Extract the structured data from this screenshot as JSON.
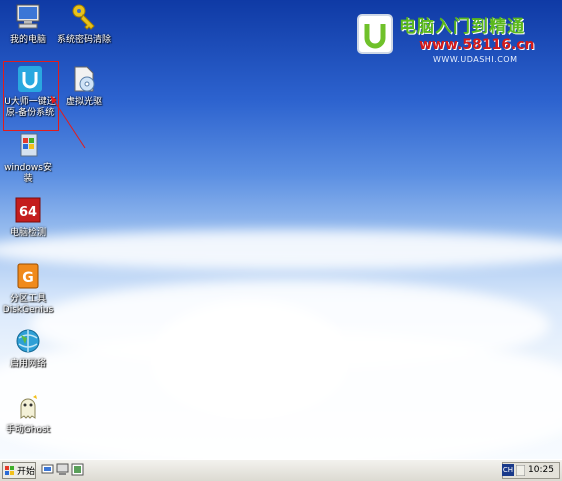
{
  "desktop": {
    "icons": [
      {
        "id": "my-computer",
        "label": "我的电脑",
        "icon": "computer-icon"
      },
      {
        "id": "password-clear",
        "label": "系统密码清除",
        "icon": "key-icon"
      },
      {
        "id": "udashi-backup",
        "label": "U大师一键还\n原-备份系统",
        "icon": "udashi-icon"
      },
      {
        "id": "virtual-drive",
        "label": "虚拟光驱",
        "icon": "cd-icon"
      },
      {
        "id": "windows-install",
        "label": "windows安装",
        "icon": "windows-setup-icon"
      },
      {
        "id": "cpu-detect",
        "label": "电脑检测",
        "icon": "aida64-icon"
      },
      {
        "id": "diskgenius",
        "label": "分区工具\nDiskGenius",
        "icon": "diskgenius-icon"
      },
      {
        "id": "network",
        "label": "启用网络",
        "icon": "network-icon"
      },
      {
        "id": "manual-ghost",
        "label": "手动Ghost",
        "icon": "ghost-icon"
      }
    ]
  },
  "logo": {
    "title": "电脑入门到精通",
    "url": "www.58116.cn",
    "sub": "WWW.UDASHI.COM"
  },
  "taskbar": {
    "start_label": "开始",
    "lang": "CH",
    "clock": "10:25"
  },
  "colors": {
    "selection": "#e21c1c",
    "logo_green": "#5ab81c",
    "logo_red": "#d31b1b"
  }
}
